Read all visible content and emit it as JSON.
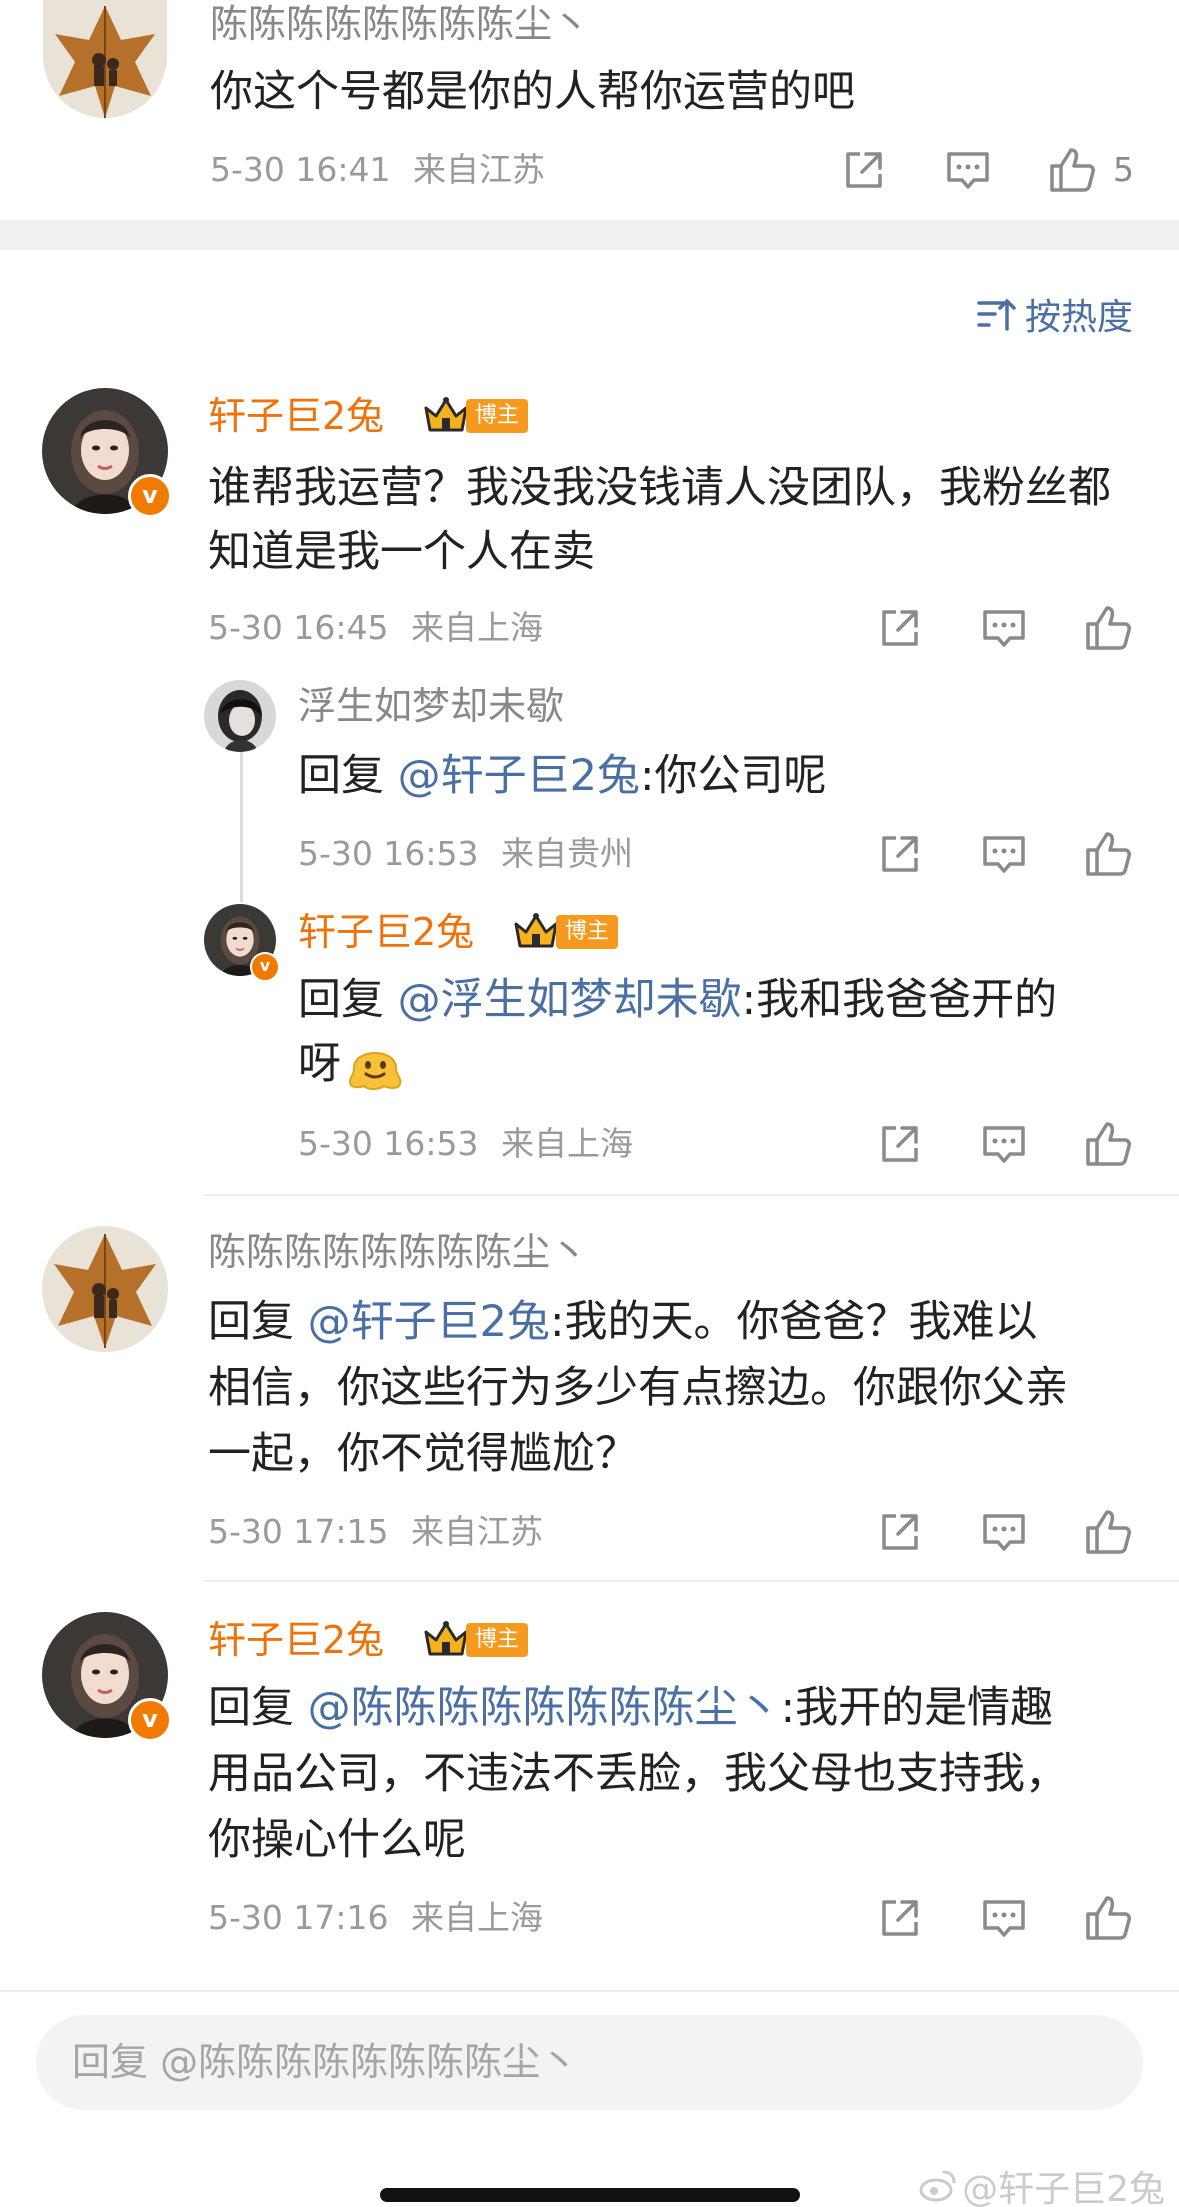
{
  "comments": [
    {
      "user": "陈陈陈陈陈陈陈陈尘丶",
      "text": "你这个号都是你的人帮你运营的吧",
      "time": "5-30 16:41",
      "location": "来自江苏",
      "likes": "5"
    }
  ],
  "sort": {
    "label": "按热度",
    "icon": "sort-icon"
  },
  "thread": {
    "main": {
      "user": "轩子巨2兔",
      "author_tag": "博主",
      "text": "谁帮我运营？我没我没钱请人没团队，我粉丝都知道是我一个人在卖",
      "time": "5-30 16:45",
      "location": "来自上海"
    },
    "replies": [
      {
        "user": "浮生如梦却未歇",
        "reply_prefix": "回复 ",
        "mention": "@轩子巨2兔",
        "text": ":你公司呢",
        "time": "5-30 16:53",
        "location": "来自贵州"
      },
      {
        "user": "轩子巨2兔",
        "author_tag": "博主",
        "reply_prefix": "回复 ",
        "mention": "@浮生如梦却未歇",
        "text_line1": ":我和我爸爸开的",
        "text_line2": "呀",
        "emoji": "melting-face-emoji",
        "time": "5-30 16:53",
        "location": "来自上海"
      }
    ]
  },
  "followups": [
    {
      "user": "陈陈陈陈陈陈陈陈尘丶",
      "reply_prefix": "回复 ",
      "mention": "@轩子巨2兔",
      "text_line1": ":我的天。你爸爸？我难以",
      "text_line2": "相信，你这些行为多少有点擦边。你跟你父亲",
      "text_line3": "一起，你不觉得尴尬？",
      "time": "5-30 17:15",
      "location": "来自江苏"
    },
    {
      "user": "轩子巨2兔",
      "author_tag": "博主",
      "reply_prefix": "回复 ",
      "mention": "@陈陈陈陈陈陈陈陈尘丶",
      "text_line1": ":我开的是情趣",
      "text_line2": "用品公司，不违法不丢脸，我父母也支持我，",
      "text_line3": "你操心什么呢",
      "time": "5-30 17:16",
      "location": "来自上海"
    }
  ],
  "reply_input": {
    "placeholder": "回复 @陈陈陈陈陈陈陈陈尘丶"
  },
  "watermark": "@轩子巨2兔",
  "colors": {
    "mention": "#4a6fa5",
    "author_name": "#f0720a",
    "verified_badge": "#f27a00",
    "author_tag": "#f59a1e"
  }
}
